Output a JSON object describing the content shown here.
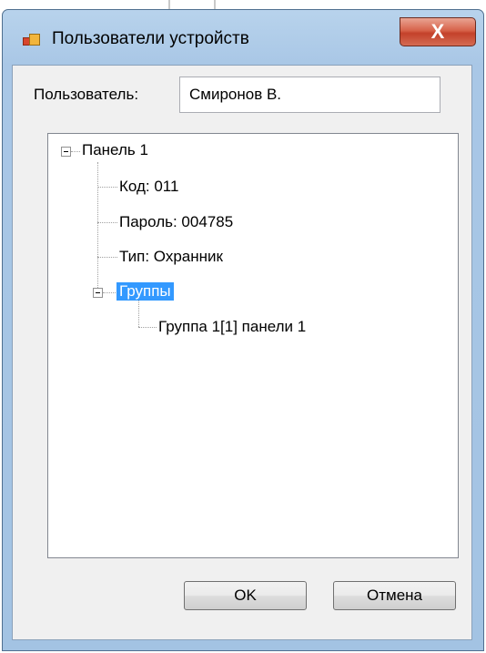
{
  "window": {
    "title": "Пользователи устройств",
    "close_label": "X"
  },
  "form": {
    "user_label": "Пользователь:",
    "user_value": "Смиронов В."
  },
  "tree": {
    "root": "Панель 1",
    "children": [
      "Код: 011",
      "Пароль: 004785",
      "Тип: Охранник"
    ],
    "groups_node": "Группы",
    "group_item": "Группа 1[1] панели 1"
  },
  "buttons": {
    "ok": "OK",
    "cancel": "Отмена"
  },
  "colors": {
    "selection": "#3399ff",
    "close_button": "#c3412a"
  }
}
